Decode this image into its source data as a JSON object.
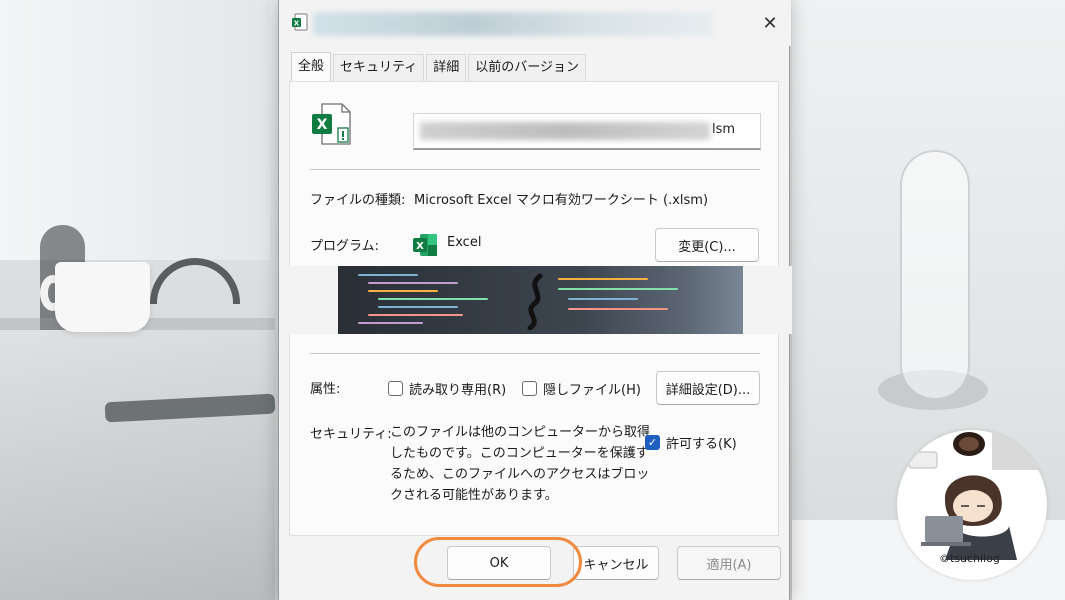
{
  "dialog": {
    "tabs": [
      "全般",
      "セキュリティ",
      "詳細",
      "以前のバージョン"
    ],
    "active_tab": 0,
    "filename_visible_suffix": "lsm",
    "file_type_label": "ファイルの種類:",
    "file_type_value": "Microsoft Excel マクロ有効ワークシート (.xlsm)",
    "program_label": "プログラム:",
    "program_value": "Excel",
    "change_button": "変更(C)...",
    "attributes_label": "属性:",
    "readonly_label": "読み取り専用(R)",
    "hidden_label": "隠しファイル(H)",
    "advanced_button": "詳細設定(D)...",
    "security_label": "セキュリティ:",
    "security_lines": [
      "このファイルは他のコンピューターから取得",
      "したものです。このコンピューターを保護す",
      "るため、このファイルへのアクセスはブロッ",
      "クされる可能性があります。"
    ],
    "unblock_label": "許可する(K)",
    "unblock_checked": true,
    "ok_button": "OK",
    "cancel_button": "キャンセル",
    "apply_button": "適用(A)",
    "close_glyph": "✕"
  },
  "colors": {
    "excel_green": "#107c41",
    "checkbox_blue": "#1f5fbf",
    "highlight_orange": "#f08a3e"
  },
  "watermark": {
    "text": "©tsuchilog"
  }
}
